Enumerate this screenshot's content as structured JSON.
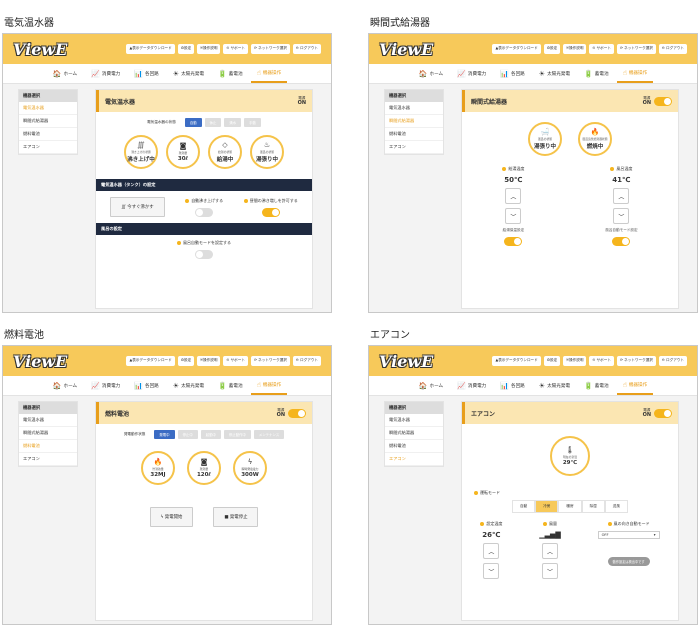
{
  "captions": [
    "電気温水器",
    "瞬間式給湯器",
    "燃料電池",
    "エアコン"
  ],
  "logo": "ViewE",
  "header_buttons": [
    "▲表示データダウンロード",
    "⚙設定",
    "🗎操作説明",
    "⊙ サポート",
    "⟳ ネットワーク選択",
    "⊖ ログアウト"
  ],
  "nav": [
    {
      "icon": "🏠",
      "label": "ホーム"
    },
    {
      "icon": "📈",
      "label": "消費電力"
    },
    {
      "icon": "📊",
      "label": "各回路"
    },
    {
      "icon": "☀",
      "label": "太陽光発電"
    },
    {
      "icon": "🔋",
      "label": "蓄電池"
    },
    {
      "icon": "☝",
      "label": "機器操作"
    }
  ],
  "sidebar": {
    "header": "機器選択",
    "items": [
      "電気温水器",
      "瞬間式給湯器",
      "燃料電池",
      "エアコン"
    ]
  },
  "power": {
    "label": "電源",
    "value": "ON"
  },
  "p1": {
    "title": "電気温水器",
    "seg_label": "電気温水器の状態",
    "segs": [
      "自動",
      "休止",
      "満水",
      "手動"
    ],
    "circles": [
      {
        "icon": "∭",
        "label": "沸き上げの状態",
        "value": "沸き上げ中"
      },
      {
        "icon": "◙",
        "label": "残湯量",
        "value": "30ℓ"
      },
      {
        "icon": "◇",
        "label": "給湯の状態",
        "value": "給湯中"
      },
      {
        "icon": "♨",
        "label": "風呂の状態",
        "value": "湯張り中"
      }
    ],
    "bar1": "電気温水器（タンク）の設定",
    "btn": "∭ 今すぐ沸かす",
    "chk1": "自動沸き上げする",
    "chk2": "昼間の沸き増しを許可する",
    "bar2": "風呂の設定",
    "chk3": "風呂自動モードを設定する"
  },
  "p2": {
    "title": "瞬間式給湯器",
    "circles": [
      {
        "icon": "🛁",
        "label": "風呂の状態",
        "value": "湯張り中"
      },
      {
        "icon": "🔥",
        "label": "風呂追焚給湯器状態",
        "value": "燃焼中"
      }
    ],
    "c1": {
      "label": "給湯温度",
      "value": "50℃",
      "tlabel": "給湯保温設定"
    },
    "c2": {
      "label": "風呂温度",
      "value": "41℃",
      "tlabel": "風呂自動モード設定"
    }
  },
  "p3": {
    "title": "燃料電池",
    "seg_label": "発電動作状態",
    "segs": [
      "発電中",
      "停止中",
      "起動中",
      "停止動作中",
      "メンテナンス"
    ],
    "circles": [
      {
        "icon": "🔥",
        "label": "貯湯熱量",
        "value": "32MJ"
      },
      {
        "icon": "◙",
        "label": "残湯量",
        "value": "120ℓ"
      },
      {
        "icon": "ϟ",
        "label": "瞬時発電電力",
        "value": "300W"
      }
    ],
    "btn1": "ϟ 発電開始",
    "btn2": "■ 発電停止"
  },
  "p4": {
    "title": "エアコン",
    "circle": {
      "icon": "🌡",
      "label": "現在の室温",
      "value": "29℃"
    },
    "mode_label": "運転モード",
    "modes": [
      "自動",
      "冷房",
      "暖房",
      "除湿",
      "送風"
    ],
    "temp": {
      "label": "設定温度",
      "value": "26℃"
    },
    "wind": {
      "label": "風量",
      "value": "▁▃▅▇"
    },
    "dir": {
      "label": "風の向き自動モード",
      "value": "OFF"
    },
    "tip": "動作設定は検出中です"
  }
}
